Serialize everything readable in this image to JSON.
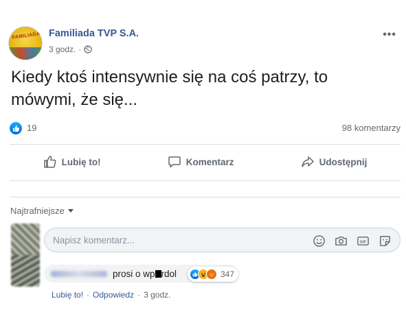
{
  "post": {
    "page_name": "Familiada TVP S.A.",
    "time": "3 godz.",
    "privacy_icon": "globe-icon",
    "more_icon": "more-icon",
    "avatar_text": "FAMILIADA",
    "text": "Kiedy ktoś intensywnie się na coś patrzy, to mówymi, że się..."
  },
  "stats": {
    "reactions_count": "19",
    "comments_count": "98 komentarzy"
  },
  "actions": {
    "like": "Lubię to!",
    "comment": "Komentarz",
    "share": "Udostępnij"
  },
  "comments_section": {
    "sort_label": "Najtrafniejsze",
    "input_placeholder": "Napisz komentarz...",
    "input_value": "",
    "input_icons": [
      "emoji-icon",
      "camera-icon",
      "gif-icon",
      "sticker-icon"
    ]
  },
  "comment": {
    "text_before": "prosi o wp",
    "text_after": "rdol",
    "reactions_count": "347",
    "reaction_icons": [
      "like",
      "haha",
      "angry"
    ],
    "like_label": "Lubię to!",
    "reply_label": "Odpowiedz",
    "time": "3 godz."
  },
  "colors": {
    "link_blue": "#385898",
    "like_blue": "#0062df",
    "text_gray": "#606770",
    "divider": "#dadde1"
  }
}
